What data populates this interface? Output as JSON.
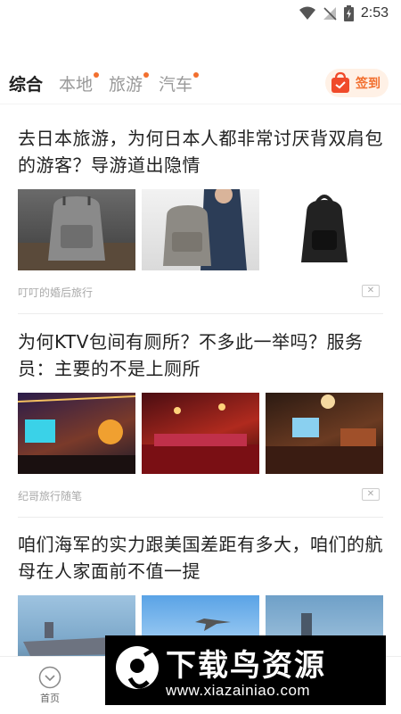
{
  "status_bar": {
    "time": "2:53"
  },
  "tabs": [
    {
      "label": "综合",
      "active": true,
      "dot": false
    },
    {
      "label": "本地",
      "active": false,
      "dot": true
    },
    {
      "label": "旅游",
      "active": false,
      "dot": true
    },
    {
      "label": "汽车",
      "active": false,
      "dot": true
    }
  ],
  "checkin": {
    "label": "签到"
  },
  "articles": [
    {
      "title": "去日本旅游，为何日本人都非常讨厌背双肩包的游客？导游道出隐情",
      "source": "叮叮的婚后旅行",
      "images": [
        "backpack-photo",
        "backpack-photo",
        "backpack-photo"
      ]
    },
    {
      "title": "为何KTV包间有厕所？不多此一举吗？服务员：主要的不是上厕所",
      "source": "纪哥旅行随笔",
      "images": [
        "ktv-room-photo",
        "ktv-room-photo",
        "ktv-room-photo"
      ]
    },
    {
      "title": "咱们海军的实力跟美国差距有多大，咱们的航母在人家面前不值一提",
      "source": "",
      "images": [
        "aircraft-carrier-photo",
        "fighter-jet-photo",
        "warship-photo"
      ]
    }
  ],
  "dismiss_glyph": "✕",
  "bottom_nav": {
    "home_label": "首页"
  },
  "watermark": {
    "brand": "下载鸟资源",
    "url": "www.xiazainiao.com"
  },
  "colors": {
    "accent": "#f26f2e",
    "text": "#222222",
    "muted": "#999999"
  }
}
